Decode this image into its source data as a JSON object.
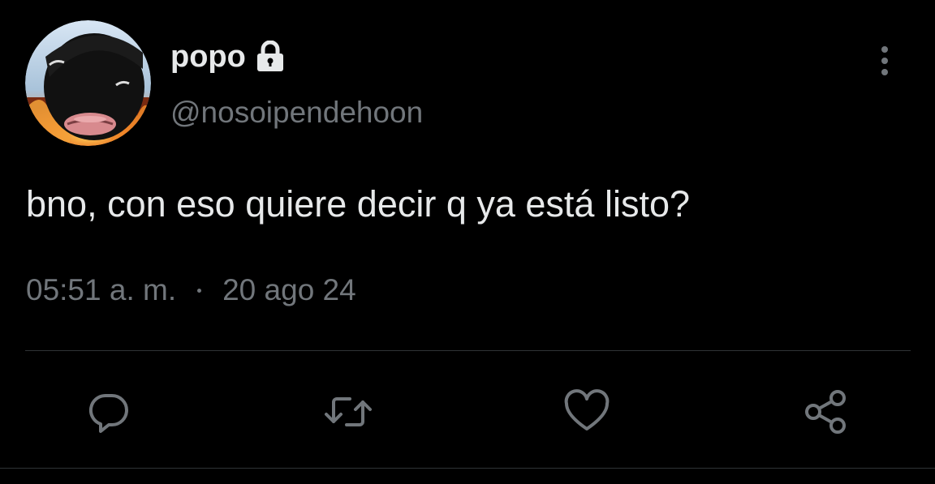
{
  "user": {
    "display_name": "popo",
    "handle": "@nosoipendehoon",
    "protected_icon": "lock-icon",
    "avatar_icon": "avatar"
  },
  "tweet": {
    "text": "bno, con eso quiere decir q ya está listo?",
    "time": "05:51 a. m.",
    "separator": "·",
    "date": "20 ago 24"
  },
  "actions": [
    {
      "name": "reply",
      "icon": "reply-icon"
    },
    {
      "name": "retweet",
      "icon": "retweet-icon"
    },
    {
      "name": "like",
      "icon": "heart-icon"
    },
    {
      "name": "share",
      "icon": "share-icon"
    }
  ],
  "menu_icon": "more-vertical-icon",
  "colors": {
    "background": "#000000",
    "primary_text": "#e7e9ea",
    "secondary_text": "#71767b",
    "divider": "#2f3336",
    "icon": "#71767b"
  }
}
